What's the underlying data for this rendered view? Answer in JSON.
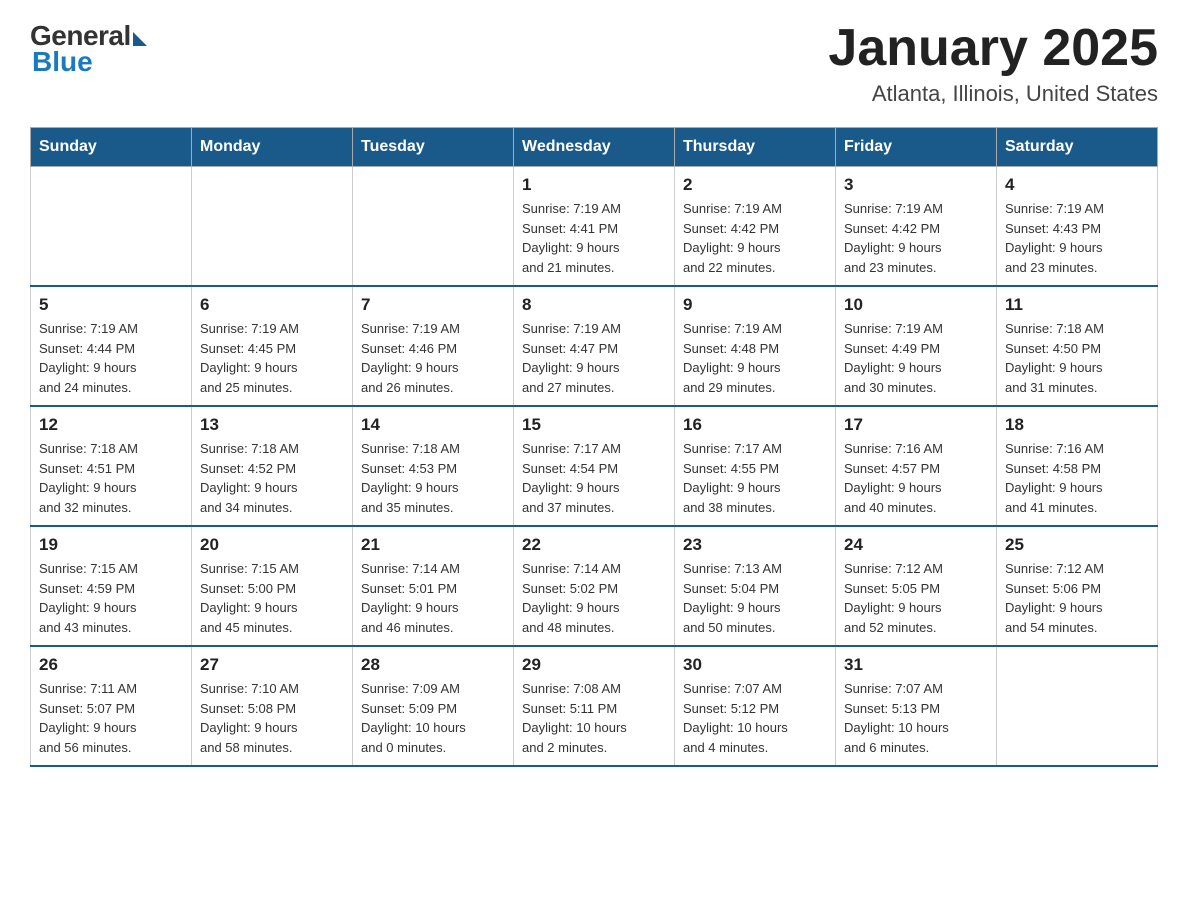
{
  "logo": {
    "general": "General",
    "blue": "Blue"
  },
  "header": {
    "title": "January 2025",
    "subtitle": "Atlanta, Illinois, United States"
  },
  "days_of_week": [
    "Sunday",
    "Monday",
    "Tuesday",
    "Wednesday",
    "Thursday",
    "Friday",
    "Saturday"
  ],
  "weeks": [
    [
      {
        "day": "",
        "info": ""
      },
      {
        "day": "",
        "info": ""
      },
      {
        "day": "",
        "info": ""
      },
      {
        "day": "1",
        "info": "Sunrise: 7:19 AM\nSunset: 4:41 PM\nDaylight: 9 hours\nand 21 minutes."
      },
      {
        "day": "2",
        "info": "Sunrise: 7:19 AM\nSunset: 4:42 PM\nDaylight: 9 hours\nand 22 minutes."
      },
      {
        "day": "3",
        "info": "Sunrise: 7:19 AM\nSunset: 4:42 PM\nDaylight: 9 hours\nand 23 minutes."
      },
      {
        "day": "4",
        "info": "Sunrise: 7:19 AM\nSunset: 4:43 PM\nDaylight: 9 hours\nand 23 minutes."
      }
    ],
    [
      {
        "day": "5",
        "info": "Sunrise: 7:19 AM\nSunset: 4:44 PM\nDaylight: 9 hours\nand 24 minutes."
      },
      {
        "day": "6",
        "info": "Sunrise: 7:19 AM\nSunset: 4:45 PM\nDaylight: 9 hours\nand 25 minutes."
      },
      {
        "day": "7",
        "info": "Sunrise: 7:19 AM\nSunset: 4:46 PM\nDaylight: 9 hours\nand 26 minutes."
      },
      {
        "day": "8",
        "info": "Sunrise: 7:19 AM\nSunset: 4:47 PM\nDaylight: 9 hours\nand 27 minutes."
      },
      {
        "day": "9",
        "info": "Sunrise: 7:19 AM\nSunset: 4:48 PM\nDaylight: 9 hours\nand 29 minutes."
      },
      {
        "day": "10",
        "info": "Sunrise: 7:19 AM\nSunset: 4:49 PM\nDaylight: 9 hours\nand 30 minutes."
      },
      {
        "day": "11",
        "info": "Sunrise: 7:18 AM\nSunset: 4:50 PM\nDaylight: 9 hours\nand 31 minutes."
      }
    ],
    [
      {
        "day": "12",
        "info": "Sunrise: 7:18 AM\nSunset: 4:51 PM\nDaylight: 9 hours\nand 32 minutes."
      },
      {
        "day": "13",
        "info": "Sunrise: 7:18 AM\nSunset: 4:52 PM\nDaylight: 9 hours\nand 34 minutes."
      },
      {
        "day": "14",
        "info": "Sunrise: 7:18 AM\nSunset: 4:53 PM\nDaylight: 9 hours\nand 35 minutes."
      },
      {
        "day": "15",
        "info": "Sunrise: 7:17 AM\nSunset: 4:54 PM\nDaylight: 9 hours\nand 37 minutes."
      },
      {
        "day": "16",
        "info": "Sunrise: 7:17 AM\nSunset: 4:55 PM\nDaylight: 9 hours\nand 38 minutes."
      },
      {
        "day": "17",
        "info": "Sunrise: 7:16 AM\nSunset: 4:57 PM\nDaylight: 9 hours\nand 40 minutes."
      },
      {
        "day": "18",
        "info": "Sunrise: 7:16 AM\nSunset: 4:58 PM\nDaylight: 9 hours\nand 41 minutes."
      }
    ],
    [
      {
        "day": "19",
        "info": "Sunrise: 7:15 AM\nSunset: 4:59 PM\nDaylight: 9 hours\nand 43 minutes."
      },
      {
        "day": "20",
        "info": "Sunrise: 7:15 AM\nSunset: 5:00 PM\nDaylight: 9 hours\nand 45 minutes."
      },
      {
        "day": "21",
        "info": "Sunrise: 7:14 AM\nSunset: 5:01 PM\nDaylight: 9 hours\nand 46 minutes."
      },
      {
        "day": "22",
        "info": "Sunrise: 7:14 AM\nSunset: 5:02 PM\nDaylight: 9 hours\nand 48 minutes."
      },
      {
        "day": "23",
        "info": "Sunrise: 7:13 AM\nSunset: 5:04 PM\nDaylight: 9 hours\nand 50 minutes."
      },
      {
        "day": "24",
        "info": "Sunrise: 7:12 AM\nSunset: 5:05 PM\nDaylight: 9 hours\nand 52 minutes."
      },
      {
        "day": "25",
        "info": "Sunrise: 7:12 AM\nSunset: 5:06 PM\nDaylight: 9 hours\nand 54 minutes."
      }
    ],
    [
      {
        "day": "26",
        "info": "Sunrise: 7:11 AM\nSunset: 5:07 PM\nDaylight: 9 hours\nand 56 minutes."
      },
      {
        "day": "27",
        "info": "Sunrise: 7:10 AM\nSunset: 5:08 PM\nDaylight: 9 hours\nand 58 minutes."
      },
      {
        "day": "28",
        "info": "Sunrise: 7:09 AM\nSunset: 5:09 PM\nDaylight: 10 hours\nand 0 minutes."
      },
      {
        "day": "29",
        "info": "Sunrise: 7:08 AM\nSunset: 5:11 PM\nDaylight: 10 hours\nand 2 minutes."
      },
      {
        "day": "30",
        "info": "Sunrise: 7:07 AM\nSunset: 5:12 PM\nDaylight: 10 hours\nand 4 minutes."
      },
      {
        "day": "31",
        "info": "Sunrise: 7:07 AM\nSunset: 5:13 PM\nDaylight: 10 hours\nand 6 minutes."
      },
      {
        "day": "",
        "info": ""
      }
    ]
  ]
}
